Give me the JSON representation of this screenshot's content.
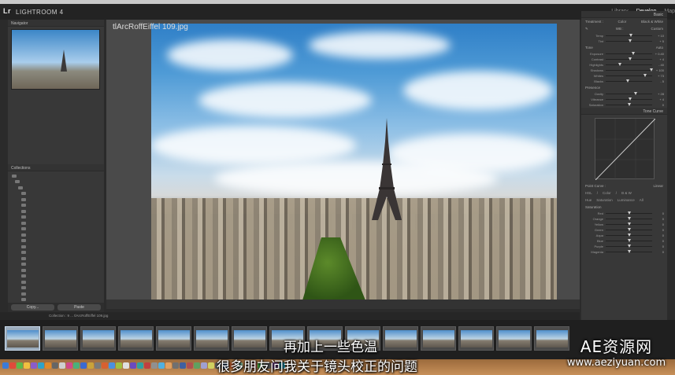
{
  "app": {
    "badge": "Lr",
    "title": "LIGHTROOM 4"
  },
  "modules": [
    {
      "label": "Library",
      "active": false
    },
    {
      "label": "Develop",
      "active": true
    },
    {
      "label": "Map",
      "active": false
    }
  ],
  "left_panel": {
    "navigator_header": "Navigator",
    "presets_rows": [
      "",
      "",
      "",
      "",
      "",
      "",
      "",
      "",
      "",
      "",
      "",
      "",
      "",
      "",
      "",
      ""
    ],
    "collections_header": "Collections",
    "collection_rows": [
      "",
      "",
      "",
      "",
      "",
      "",
      "",
      "",
      "",
      "",
      "",
      "",
      "",
      "",
      "",
      "",
      "",
      "",
      "",
      "",
      "",
      ""
    ],
    "copy_label": "Copy...",
    "paste_label": "Paste"
  },
  "photo": {
    "name": "tlArcRoffEiffel 109.jpg",
    "info_line1": "",
    "info_line2": ""
  },
  "filmstrip": {
    "path_text": "Collection : 9 ... tlArcRoffEiffel 109.jpg"
  },
  "right_panel": {
    "basic_header": "Basic",
    "treatment_label": "Treatment :",
    "color_label": "Color",
    "bw_label": "Black & White",
    "wb_label": "WB :",
    "wb_value": "Custom",
    "tone_label": "Tone",
    "tone_auto": "Auto",
    "presence_label": "Presence",
    "tone_curve_header": "Tone Curve",
    "point_curve_label": "Point Curve :",
    "point_curve_value": "Linear",
    "hsl_tabs": [
      "HSL",
      "/",
      "Color",
      "/",
      "B & W"
    ],
    "hsl_subtabs": [
      "Hue",
      "Saturation",
      "Luminance",
      "All"
    ],
    "saturation_label": "Saturation",
    "sliders": [
      {
        "label": "Temp",
        "value": "+ 10",
        "pos": 0.55
      },
      {
        "label": "Tint",
        "value": "+ 5",
        "pos": 0.53
      },
      {
        "label": "Exposure",
        "value": "+ 0.40",
        "pos": 0.6
      },
      {
        "label": "Contrast",
        "value": "+ 4",
        "pos": 0.52
      },
      {
        "label": "Highlights",
        "value": "- 40",
        "pos": 0.3
      },
      {
        "label": "Shadows",
        "value": "+ 100",
        "pos": 0.98
      },
      {
        "label": "Whites",
        "value": "+ 73",
        "pos": 0.85
      },
      {
        "label": "Blacks",
        "value": "- 5",
        "pos": 0.47
      },
      {
        "label": "Clarity",
        "value": "+ 28",
        "pos": 0.64
      },
      {
        "label": "Vibrance",
        "value": "+ 4",
        "pos": 0.52
      },
      {
        "label": "Saturation",
        "value": "0",
        "pos": 0.5
      }
    ],
    "hsl_sliders": [
      {
        "label": "Red",
        "value": "0"
      },
      {
        "label": "Orange",
        "value": "0"
      },
      {
        "label": "Yellow",
        "value": "0"
      },
      {
        "label": "Green",
        "value": "0"
      },
      {
        "label": "Aqua",
        "value": "0"
      },
      {
        "label": "Blue",
        "value": "0"
      },
      {
        "label": "Purple",
        "value": "0"
      },
      {
        "label": "Magenta",
        "value": "0"
      }
    ]
  },
  "subtitles": {
    "line1": "再加上一些色温",
    "line2": "很多朋友问我关于镜头校正的问题"
  },
  "watermark": {
    "title": "AE资源网",
    "url": "www.aeziyuan.com"
  },
  "colors": {
    "panel_bg": "#383838",
    "center_bg": "#4a4a4a",
    "dock": "#c79059"
  }
}
